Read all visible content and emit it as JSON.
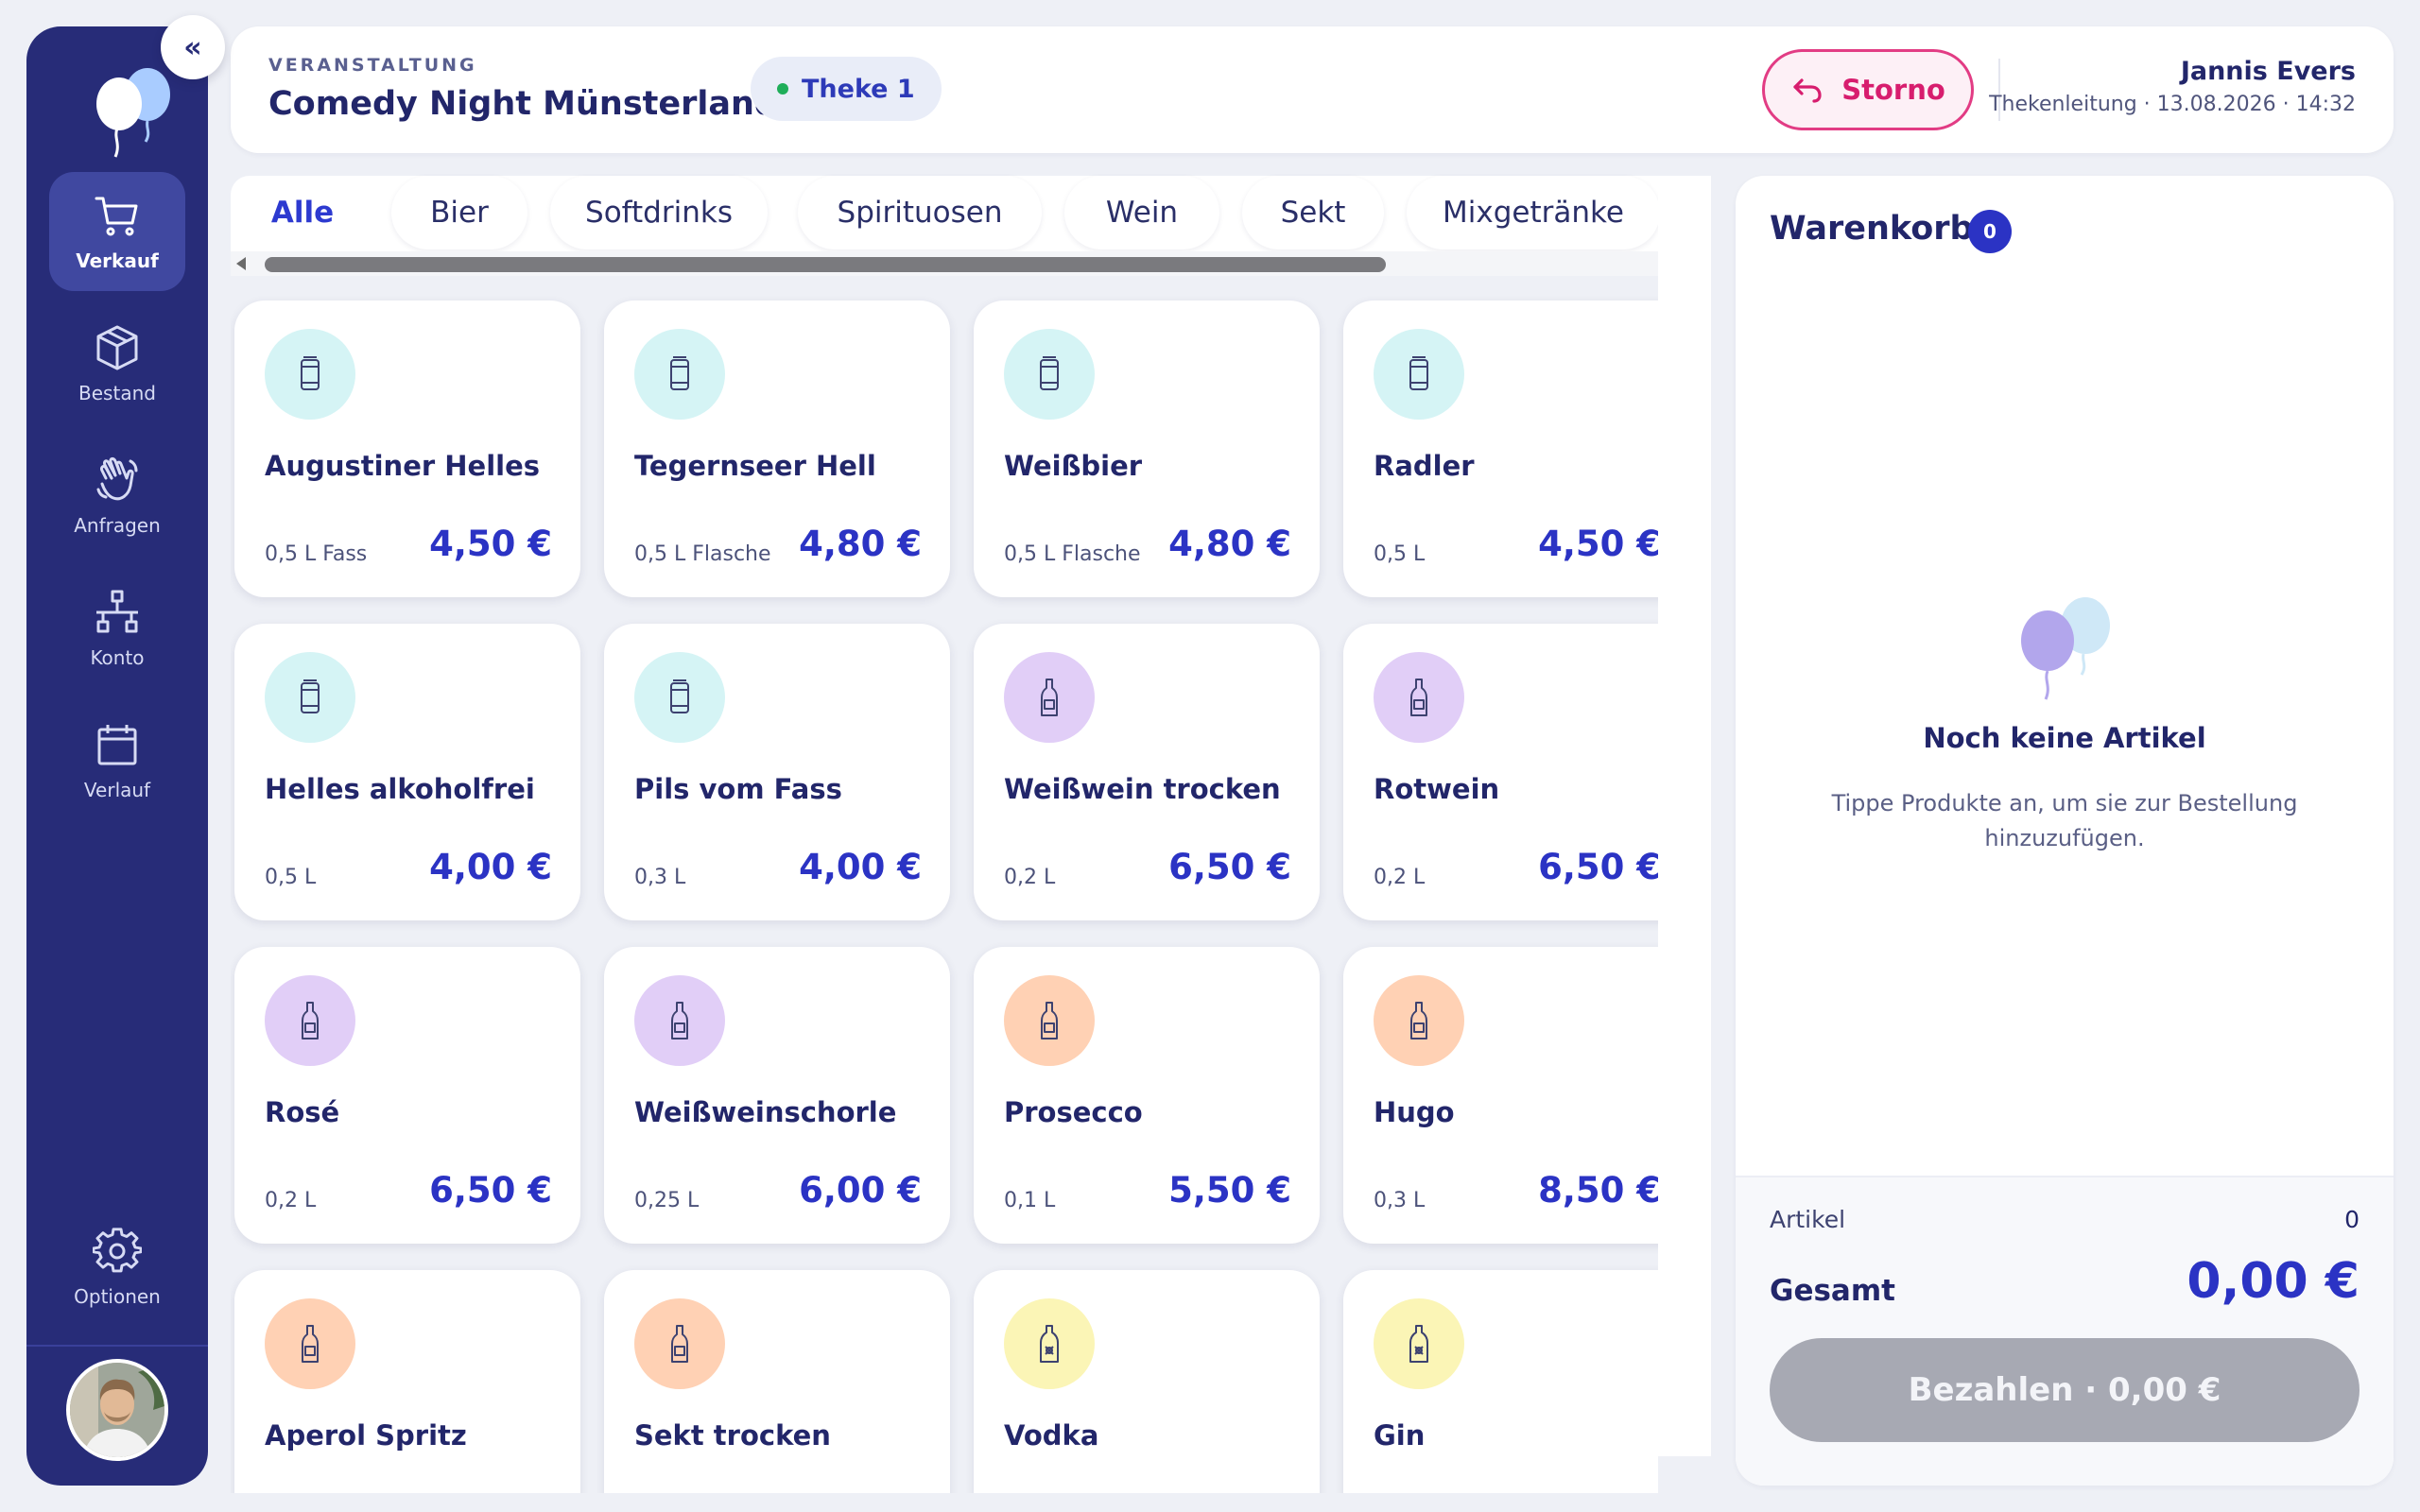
{
  "sidebar": {
    "collapse_label": "«",
    "items": [
      {
        "label": "Verkauf",
        "icon": "cart-icon",
        "active": true
      },
      {
        "label": "Bestand",
        "icon": "box-icon",
        "active": false
      },
      {
        "label": "Anfragen",
        "icon": "wave-hand-icon",
        "active": false
      },
      {
        "label": "Konto",
        "icon": "network-icon",
        "active": false
      },
      {
        "label": "Verlauf",
        "icon": "calendar-icon",
        "active": false
      }
    ],
    "options": {
      "label": "Optionen",
      "icon": "gear-icon"
    }
  },
  "header": {
    "kicker": "VERANSTALTUNG",
    "event_title": "Comedy Night Münsterland",
    "station": "Theke 1",
    "storno_label": "Storno",
    "user_name": "Jannis Evers",
    "user_meta": "Thekenleitung · 13.08.2026 · 14:32"
  },
  "categories": [
    {
      "label": "Alle",
      "active": true
    },
    {
      "label": "Bier",
      "active": false
    },
    {
      "label": "Softdrinks",
      "active": false
    },
    {
      "label": "Spirituosen",
      "active": false
    },
    {
      "label": "Wein",
      "active": false
    },
    {
      "label": "Sekt",
      "active": false
    },
    {
      "label": "Mixgetränke",
      "active": false
    }
  ],
  "products": [
    {
      "name": "Augustiner Helles",
      "size": "0,5 L Fass",
      "price": "4,50 €",
      "kind": "can",
      "color": "#d5f4f5"
    },
    {
      "name": "Tegernseer Hell",
      "size": "0,5 L Flasche",
      "price": "4,80 €",
      "kind": "can",
      "color": "#d5f4f5"
    },
    {
      "name": "Weißbier",
      "size": "0,5 L Flasche",
      "price": "4,80 €",
      "kind": "can",
      "color": "#d5f4f5"
    },
    {
      "name": "Radler",
      "size": "0,5 L",
      "price": "4,50 €",
      "kind": "can",
      "color": "#d5f4f5"
    },
    {
      "name": "Helles alkoholfrei",
      "size": "0,5 L",
      "price": "4,00 €",
      "kind": "can",
      "color": "#d5f4f5"
    },
    {
      "name": "Pils vom Fass",
      "size": "0,3 L",
      "price": "4,00 €",
      "kind": "can",
      "color": "#d5f4f5"
    },
    {
      "name": "Weißwein trocken",
      "size": "0,2 L",
      "price": "6,50 €",
      "kind": "bottle",
      "color": "#e1cef7"
    },
    {
      "name": "Rotwein",
      "size": "0,2 L",
      "price": "6,50 €",
      "kind": "bottle",
      "color": "#e1cef7"
    },
    {
      "name": "Rosé",
      "size": "0,2 L",
      "price": "6,50 €",
      "kind": "bottle",
      "color": "#e1cef7"
    },
    {
      "name": "Weißweinschorle",
      "size": "0,25 L",
      "price": "6,00 €",
      "kind": "bottle",
      "color": "#e1cef7"
    },
    {
      "name": "Prosecco",
      "size": "0,1 L",
      "price": "5,50 €",
      "kind": "bottle",
      "color": "#ffd1b4"
    },
    {
      "name": "Hugo",
      "size": "0,3 L",
      "price": "8,50 €",
      "kind": "bottle",
      "color": "#ffd1b4"
    },
    {
      "name": "Aperol Spritz",
      "size": "",
      "price": "",
      "kind": "bottle",
      "color": "#ffd1b4"
    },
    {
      "name": "Sekt trocken",
      "size": "",
      "price": "",
      "kind": "bottle",
      "color": "#ffd1b4"
    },
    {
      "name": "Vodka",
      "size": "",
      "price": "",
      "kind": "spirit",
      "color": "#fbf5b6"
    },
    {
      "name": "Gin",
      "size": "",
      "price": "",
      "kind": "spirit",
      "color": "#fbf5b6"
    }
  ],
  "cart": {
    "title": "Warenkorb",
    "count_badge": "0",
    "empty_title": "Noch keine Artikel",
    "empty_text": "Tippe Produkte an, um sie zur Bestellung hinzuzufügen.",
    "articles_label": "Artikel",
    "articles_value": "0",
    "total_label": "Gesamt",
    "total_value": "0,00 €",
    "pay_label": "Bezahlen · 0,00 €"
  },
  "colors": {
    "sidebar": "#272c78",
    "accent": "#2b33c4",
    "storno": "#d71d6e",
    "status_online": "#1fae5a"
  }
}
